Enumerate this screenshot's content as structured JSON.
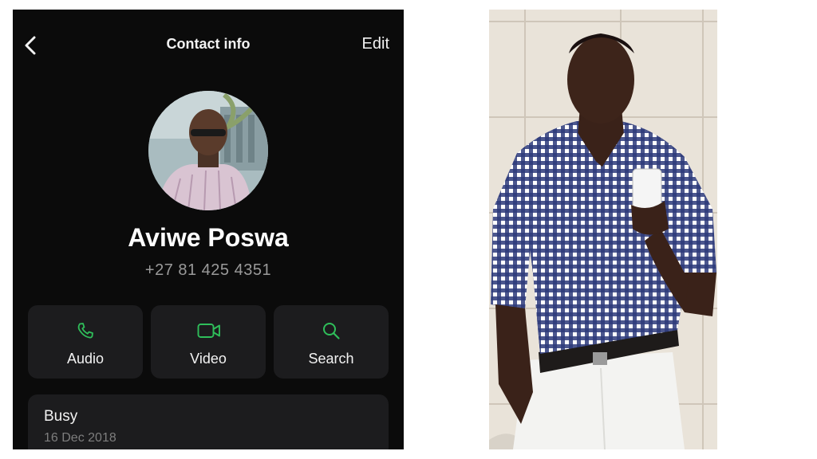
{
  "header": {
    "title": "Contact info",
    "edit_label": "Edit",
    "back_icon": "chevron-left-icon"
  },
  "contact": {
    "name": "Aviwe Poswa",
    "phone": "+27 81 425 4351"
  },
  "actions": [
    {
      "label": "Audio",
      "icon": "phone-icon"
    },
    {
      "label": "Video",
      "icon": "video-camera-icon"
    },
    {
      "label": "Search",
      "icon": "search-icon"
    }
  ],
  "status": {
    "text": "Busy",
    "date": "16 Dec 2018"
  },
  "colors": {
    "background": "#0b0b0b",
    "card": "#1c1c1e",
    "accent_green": "#2fbe5a",
    "secondary_text": "#9a9a9a"
  }
}
